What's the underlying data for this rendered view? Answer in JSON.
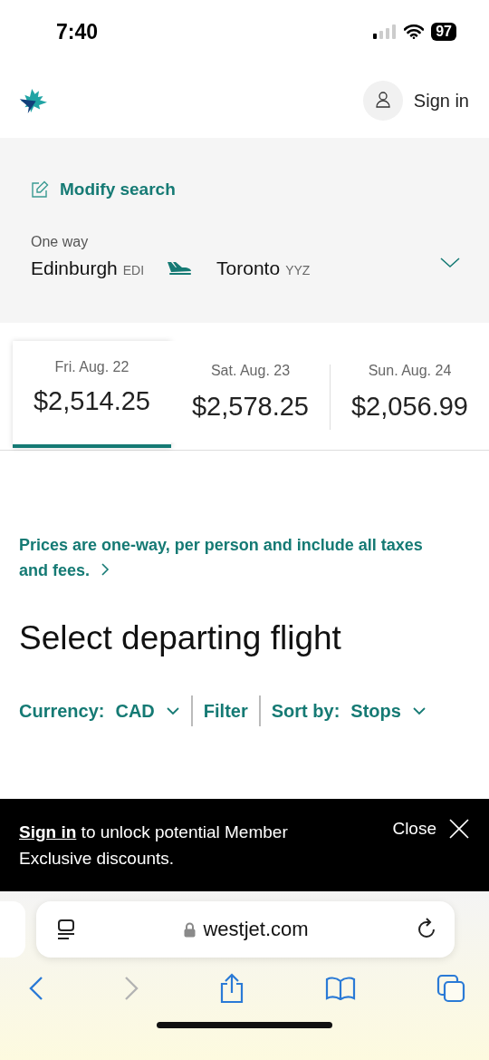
{
  "status_bar": {
    "time": "7:40",
    "battery": "97"
  },
  "header": {
    "sign_in": "Sign in"
  },
  "search": {
    "modify": "Modify search",
    "trip_type": "One way",
    "origin": {
      "city": "Edinburgh",
      "code": "EDI"
    },
    "destination": {
      "city": "Toronto",
      "code": "YYZ"
    }
  },
  "dates": [
    {
      "date": "Fri. Aug. 22",
      "price": "$2,514.25",
      "selected": true
    },
    {
      "date": "Sat. Aug. 23",
      "price": "$2,578.25",
      "selected": false
    },
    {
      "date": "Sun. Aug. 24",
      "price": "$2,056.99",
      "selected": false
    }
  ],
  "price_note": "Prices are one-way, per person and include all taxes and fees.",
  "heading": "Select departing flight",
  "controls": [
    {
      "kind": "dropdown",
      "label": "Currency:",
      "value": "CAD"
    },
    {
      "kind": "button",
      "label": "Filter"
    },
    {
      "kind": "dropdown",
      "label": "Sort by:",
      "value": "Stops"
    }
  ],
  "banner": {
    "link": "Sign in",
    "text": "to unlock potential Member Exclusive discounts.",
    "close": "Close"
  },
  "browser": {
    "url": "westjet.com",
    "toolbar": [
      {
        "kind": "back",
        "disabled": false
      },
      {
        "kind": "forward",
        "disabled": true
      },
      {
        "kind": "share",
        "disabled": false
      },
      {
        "kind": "bookmarks",
        "disabled": false
      },
      {
        "kind": "tabs",
        "disabled": false
      }
    ]
  }
}
